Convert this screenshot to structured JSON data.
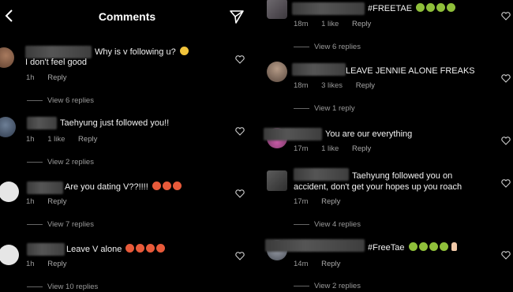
{
  "left": {
    "header": {
      "title": "Comments"
    },
    "comments": [
      {
        "text": "Why is v following u?",
        "text2": "I don't feel good",
        "time": "1h",
        "likes": "",
        "reply": "Reply",
        "view_replies": "View 6 replies"
      },
      {
        "text": "Taehyung just followed you!!",
        "time": "1h",
        "likes": "1 like",
        "reply": "Reply",
        "view_replies": "View 2 replies"
      },
      {
        "text": "Are you dating V??!!!!",
        "time": "1h",
        "likes": "",
        "reply": "Reply",
        "view_replies": "View 7 replies"
      },
      {
        "text": "Leave V alone",
        "time": "1h",
        "likes": "",
        "reply": "Reply",
        "view_replies": "View 10 replies"
      }
    ]
  },
  "right": {
    "comments": [
      {
        "text": "#FREETAE",
        "time": "18m",
        "likes": "1 like",
        "reply": "Reply",
        "view_replies": "View 6 replies"
      },
      {
        "text": "LEAVE JENNIE ALONE FREAKS",
        "time": "18m",
        "likes": "3 likes",
        "reply": "Reply",
        "view_replies": "View 1 reply"
      },
      {
        "text": "You are our everything",
        "time": "17m",
        "likes": "1 like",
        "reply": "Reply",
        "view_replies": ""
      },
      {
        "text": "Taehyung followed you on",
        "text2": "accident, don't get your hopes up you roach",
        "time": "17m",
        "likes": "",
        "reply": "Reply",
        "view_replies": "View 4 replies"
      },
      {
        "text": "#FreeTae",
        "time": "14m",
        "likes": "",
        "reply": "Reply",
        "view_replies": "View 2 replies"
      }
    ]
  },
  "icons": {
    "back": "chevron-left-icon",
    "send": "paper-plane-icon",
    "like": "heart-outline-icon"
  },
  "colors": {
    "background": "#000000",
    "text": "#ffffff",
    "meta": "#9a9a9a"
  }
}
